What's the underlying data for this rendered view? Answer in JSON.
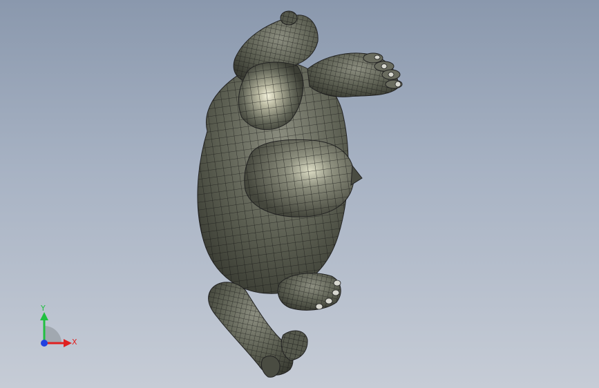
{
  "viewport": {
    "background_top": "#8a98ad",
    "background_bottom": "#c6ccd6",
    "model_name": "",
    "model_fill": "#55584c",
    "mesh_color": "#111111",
    "highlight_color": "#f2f0d8"
  },
  "triad": {
    "x_label": "X",
    "y_label": "Y",
    "x_color": "#e02020",
    "y_color": "#20c040",
    "z_color": "#2040e0"
  }
}
